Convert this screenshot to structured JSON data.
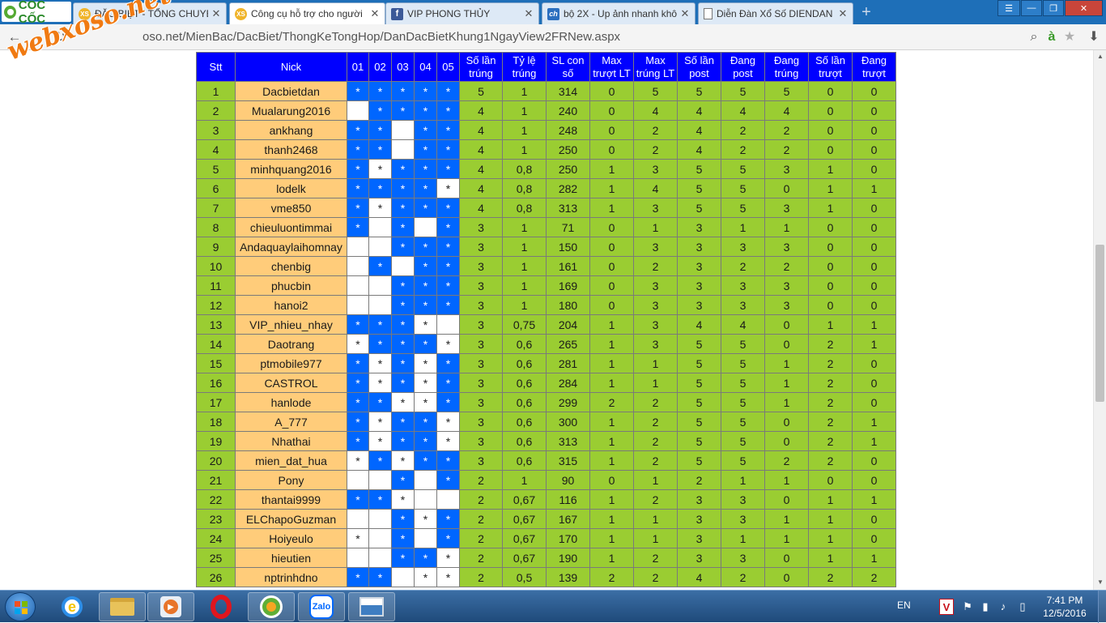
{
  "browser": {
    "logo_text": "CỐC CỐC",
    "tabs": [
      {
        "title": "ĐẶC BIỆT - TỔNG CHUYÊN",
        "icon": "xs-icon",
        "active": false
      },
      {
        "title": "Công cụ hỗ trợ cho người",
        "icon": "xs-icon",
        "active": true
      },
      {
        "title": "VIP PHONG THỦY",
        "icon": "facebook-icon",
        "active": false
      },
      {
        "title": "bộ 2X - Up ảnh nhanh khô",
        "icon": "ch-icon",
        "active": false
      },
      {
        "title": "Diễn Đàn Xổ Số DIENDAN",
        "icon": "page-icon",
        "active": false
      }
    ],
    "url": "oso.net/MienBac/DacBiet/ThongKeTongHop/DanDacBietKhung1NgayView2FRNew.aspx"
  },
  "watermark": "webxoso.net",
  "table": {
    "headers": [
      "Stt",
      "Nick",
      "01",
      "02",
      "03",
      "04",
      "05",
      "Số lần trúng",
      "Tỷ lệ trúng",
      "SL con số",
      "Max trượt LT",
      "Max trúng LT",
      "Số lần post",
      "Đang post",
      "Đang trúng",
      "Số lần trượt",
      "Đang trượt"
    ],
    "mark": "*",
    "rows": [
      {
        "stt": "1",
        "nick": "Dacbietdan",
        "days": [
          "B*",
          "B*",
          "B*",
          "B*",
          "B*"
        ],
        "nums": [
          "5",
          "1",
          "314",
          "0",
          "5",
          "5",
          "5",
          "5",
          "0",
          "0"
        ]
      },
      {
        "stt": "2",
        "nick": "Mualarung2016",
        "days": [
          "W",
          "B*",
          "B*",
          "B*",
          "B*"
        ],
        "nums": [
          "4",
          "1",
          "240",
          "0",
          "4",
          "4",
          "4",
          "4",
          "0",
          "0"
        ]
      },
      {
        "stt": "3",
        "nick": "ankhang",
        "days": [
          "B*",
          "B*",
          "W",
          "B*",
          "B*"
        ],
        "nums": [
          "4",
          "1",
          "248",
          "0",
          "2",
          "4",
          "2",
          "2",
          "0",
          "0"
        ]
      },
      {
        "stt": "4",
        "nick": "thanh2468",
        "days": [
          "B*",
          "B*",
          "W",
          "B*",
          "B*"
        ],
        "nums": [
          "4",
          "1",
          "250",
          "0",
          "2",
          "4",
          "2",
          "2",
          "0",
          "0"
        ]
      },
      {
        "stt": "5",
        "nick": "minhquang2016",
        "days": [
          "B*",
          "W*",
          "B*",
          "B*",
          "B*"
        ],
        "nums": [
          "4",
          "0,8",
          "250",
          "1",
          "3",
          "5",
          "5",
          "3",
          "1",
          "0"
        ]
      },
      {
        "stt": "6",
        "nick": "lodelk",
        "days": [
          "B*",
          "B*",
          "B*",
          "B*",
          "W*"
        ],
        "nums": [
          "4",
          "0,8",
          "282",
          "1",
          "4",
          "5",
          "5",
          "0",
          "1",
          "1"
        ]
      },
      {
        "stt": "7",
        "nick": "vme850",
        "days": [
          "B*",
          "W*",
          "B*",
          "B*",
          "B*"
        ],
        "nums": [
          "4",
          "0,8",
          "313",
          "1",
          "3",
          "5",
          "5",
          "3",
          "1",
          "0"
        ]
      },
      {
        "stt": "8",
        "nick": "chieuluontimmai",
        "days": [
          "B*",
          "W",
          "B*",
          "W",
          "B*"
        ],
        "nums": [
          "3",
          "1",
          "71",
          "0",
          "1",
          "3",
          "1",
          "1",
          "0",
          "0"
        ]
      },
      {
        "stt": "9",
        "nick": "Andaquaylaihomnay",
        "days": [
          "W",
          "W",
          "B*",
          "B*",
          "B*"
        ],
        "nums": [
          "3",
          "1",
          "150",
          "0",
          "3",
          "3",
          "3",
          "3",
          "0",
          "0"
        ]
      },
      {
        "stt": "10",
        "nick": "chenbig",
        "days": [
          "W",
          "B*",
          "W",
          "B*",
          "B*"
        ],
        "nums": [
          "3",
          "1",
          "161",
          "0",
          "2",
          "3",
          "2",
          "2",
          "0",
          "0"
        ]
      },
      {
        "stt": "11",
        "nick": "phucbin",
        "days": [
          "W",
          "W",
          "B*",
          "B*",
          "B*"
        ],
        "nums": [
          "3",
          "1",
          "169",
          "0",
          "3",
          "3",
          "3",
          "3",
          "0",
          "0"
        ]
      },
      {
        "stt": "12",
        "nick": "hanoi2",
        "days": [
          "W",
          "W",
          "B*",
          "B*",
          "B*"
        ],
        "nums": [
          "3",
          "1",
          "180",
          "0",
          "3",
          "3",
          "3",
          "3",
          "0",
          "0"
        ]
      },
      {
        "stt": "13",
        "nick": "VIP_nhieu_nhay",
        "days": [
          "B*",
          "B*",
          "B*",
          "W*",
          "W"
        ],
        "nums": [
          "3",
          "0,75",
          "204",
          "1",
          "3",
          "4",
          "4",
          "0",
          "1",
          "1"
        ]
      },
      {
        "stt": "14",
        "nick": "Daotrang",
        "days": [
          "W*",
          "B*",
          "B*",
          "B*",
          "W*"
        ],
        "nums": [
          "3",
          "0,6",
          "265",
          "1",
          "3",
          "5",
          "5",
          "0",
          "2",
          "1"
        ]
      },
      {
        "stt": "15",
        "nick": "ptmobile977",
        "days": [
          "B*",
          "W*",
          "B*",
          "W*",
          "B*"
        ],
        "nums": [
          "3",
          "0,6",
          "281",
          "1",
          "1",
          "5",
          "5",
          "1",
          "2",
          "0"
        ]
      },
      {
        "stt": "16",
        "nick": "CASTROL",
        "days": [
          "B*",
          "W*",
          "B*",
          "W*",
          "B*"
        ],
        "nums": [
          "3",
          "0,6",
          "284",
          "1",
          "1",
          "5",
          "5",
          "1",
          "2",
          "0"
        ]
      },
      {
        "stt": "17",
        "nick": "hanlode",
        "days": [
          "B*",
          "B*",
          "W*",
          "W*",
          "B*"
        ],
        "nums": [
          "3",
          "0,6",
          "299",
          "2",
          "2",
          "5",
          "5",
          "1",
          "2",
          "0"
        ]
      },
      {
        "stt": "18",
        "nick": "A_777",
        "days": [
          "B*",
          "W*",
          "B*",
          "B*",
          "W*"
        ],
        "nums": [
          "3",
          "0,6",
          "300",
          "1",
          "2",
          "5",
          "5",
          "0",
          "2",
          "1"
        ]
      },
      {
        "stt": "19",
        "nick": "Nhathai",
        "days": [
          "B*",
          "W*",
          "B*",
          "B*",
          "W*"
        ],
        "nums": [
          "3",
          "0,6",
          "313",
          "1",
          "2",
          "5",
          "5",
          "0",
          "2",
          "1"
        ]
      },
      {
        "stt": "20",
        "nick": "mien_dat_hua",
        "days": [
          "W*",
          "B*",
          "W*",
          "B*",
          "B*"
        ],
        "nums": [
          "3",
          "0,6",
          "315",
          "1",
          "2",
          "5",
          "5",
          "2",
          "2",
          "0"
        ]
      },
      {
        "stt": "21",
        "nick": "Pony",
        "days": [
          "W",
          "W",
          "B*",
          "W",
          "B*"
        ],
        "nums": [
          "2",
          "1",
          "90",
          "0",
          "1",
          "2",
          "1",
          "1",
          "0",
          "0"
        ]
      },
      {
        "stt": "22",
        "nick": "thantai9999",
        "days": [
          "B*",
          "B*",
          "W*",
          "W",
          "W"
        ],
        "nums": [
          "2",
          "0,67",
          "116",
          "1",
          "2",
          "3",
          "3",
          "0",
          "1",
          "1"
        ]
      },
      {
        "stt": "23",
        "nick": "ELChapoGuzman",
        "days": [
          "W",
          "W",
          "B*",
          "W*",
          "B*"
        ],
        "nums": [
          "2",
          "0,67",
          "167",
          "1",
          "1",
          "3",
          "3",
          "1",
          "1",
          "0"
        ]
      },
      {
        "stt": "24",
        "nick": "Hoiyeulo",
        "days": [
          "W*",
          "W",
          "B*",
          "W",
          "B*"
        ],
        "nums": [
          "2",
          "0,67",
          "170",
          "1",
          "1",
          "3",
          "1",
          "1",
          "1",
          "0"
        ]
      },
      {
        "stt": "25",
        "nick": "hieutien",
        "days": [
          "W",
          "W",
          "B*",
          "B*",
          "W*"
        ],
        "nums": [
          "2",
          "0,67",
          "190",
          "1",
          "2",
          "3",
          "3",
          "0",
          "1",
          "1"
        ]
      },
      {
        "stt": "26",
        "nick": "nptrinhdno",
        "days": [
          "B*",
          "B*",
          "W",
          "W*",
          "W*"
        ],
        "nums": [
          "2",
          "0,5",
          "139",
          "2",
          "2",
          "4",
          "2",
          "0",
          "2",
          "2"
        ]
      }
    ]
  },
  "taskbar": {
    "apps": [
      "internet-explorer-icon",
      "file-explorer-icon",
      "media-player-icon",
      "opera-icon",
      "coccoc-icon",
      "zalo-icon",
      "photo-viewer-icon"
    ],
    "zalo_label": "Zalo",
    "language": "EN",
    "clock_time": "7:41 PM",
    "clock_date": "12/5/2016"
  },
  "colors": {
    "tabbar": "#1e6fb8",
    "header_blue": "#0000ff",
    "cell_blue": "#0066ff",
    "green": "#9acd32",
    "nick_orange": "#ffcc7a"
  }
}
